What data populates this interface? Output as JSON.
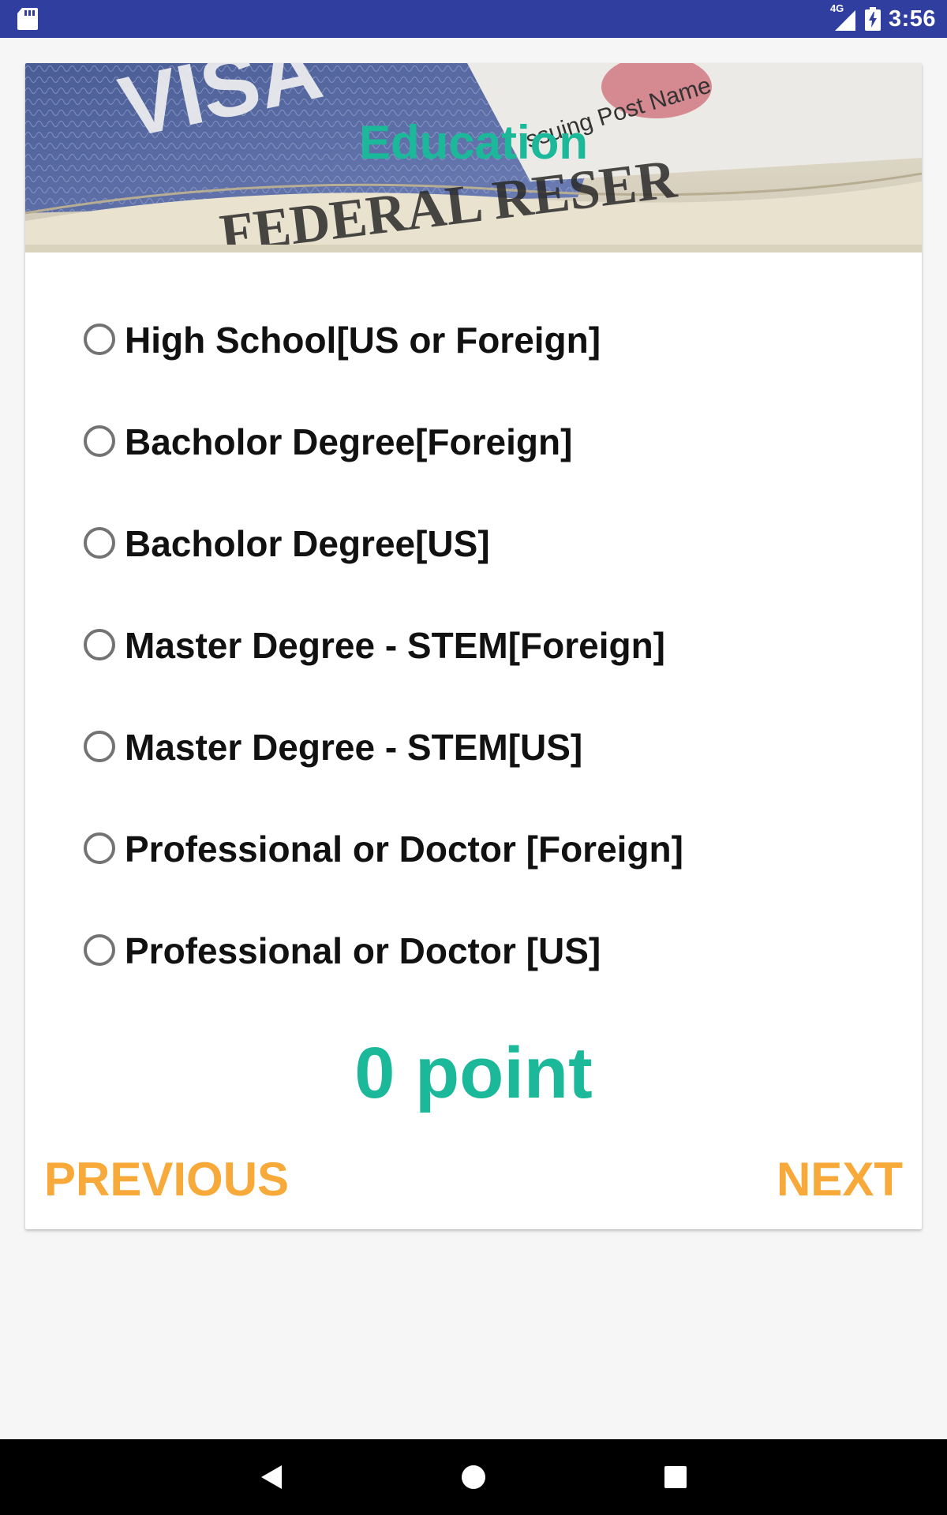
{
  "status_bar": {
    "time": "3:56",
    "network": "4G",
    "icons": [
      "sd-card-icon",
      "signal-icon",
      "battery-charging-icon"
    ]
  },
  "banner": {
    "title": "Education",
    "image_text": [
      "VISA",
      "Issuing Post Name",
      "FEDERAL RESER"
    ]
  },
  "options": [
    {
      "label": "High School[US or Foreign]",
      "selected": false
    },
    {
      "label": "Bacholor Degree[Foreign]",
      "selected": false
    },
    {
      "label": "Bacholor Degree[US]",
      "selected": false
    },
    {
      "label": "Master Degree - STEM[Foreign]",
      "selected": false
    },
    {
      "label": "Master Degree - STEM[US]",
      "selected": false
    },
    {
      "label": "Professional or Doctor [Foreign]",
      "selected": false
    },
    {
      "label": "Professional or Doctor [US]",
      "selected": false
    }
  ],
  "points_text": "0 point",
  "buttons": {
    "previous": "PREVIOUS",
    "next": "NEXT"
  },
  "colors": {
    "status_bar": "#303f9f",
    "accent_teal": "#1bb99a",
    "button_orange": "#f7a93a"
  },
  "nav_bar": {
    "icons": [
      "back-icon",
      "home-icon",
      "recents-icon"
    ]
  }
}
